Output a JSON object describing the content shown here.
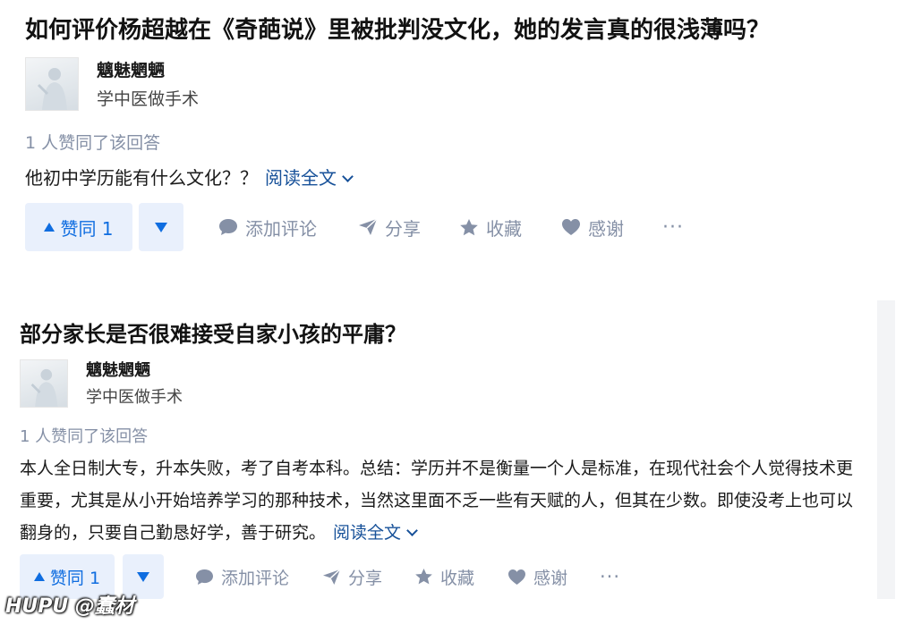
{
  "answers": [
    {
      "question_title": "如何评价杨超越在《奇葩说》里被批判没文化，她的发言真的很浅薄吗？",
      "author_name": "魑魅魍魉",
      "author_desc": "学中医做手术",
      "votes_text": "1 人赞同了该回答",
      "answer_text": "他初中学历能有什么文化？？",
      "read_more": "阅读全文",
      "vote_up_label": "赞同 1",
      "comment_label": "添加评论",
      "share_label": "分享",
      "collect_label": "收藏",
      "thanks_label": "感谢",
      "more_label": "···"
    },
    {
      "question_title": "部分家长是否很难接受自家小孩的平庸？",
      "author_name": "魑魅魍魉",
      "author_desc": "学中医做手术",
      "votes_text": "1 人赞同了该回答",
      "answer_text": "本人全日制大专，升本失败，考了自考本科。总结：学历并不是衡量一个人是标准，在现代社会个人觉得技术更重要，尤其是从小开始培养学习的那种技术，当然这里面不乏一些有天赋的人，但其在少数。即使没考上也可以翻身的，只要自己勤恳好学，善于研究。",
      "read_more": "阅读全文",
      "vote_up_label": "赞同 1",
      "comment_label": "添加评论",
      "share_label": "分享",
      "collect_label": "收藏",
      "thanks_label": "感谢",
      "more_label": "···"
    }
  ],
  "watermark": "HUPU @蠢材",
  "colors": {
    "accent": "#0f6de0",
    "accent_bg": "#e9f0fc",
    "meta": "#8590a6",
    "link": "#175199"
  },
  "icons": [
    "triangle-up-icon",
    "triangle-down-icon",
    "comment-icon",
    "share-icon",
    "star-icon",
    "heart-icon",
    "chevron-down-icon"
  ]
}
